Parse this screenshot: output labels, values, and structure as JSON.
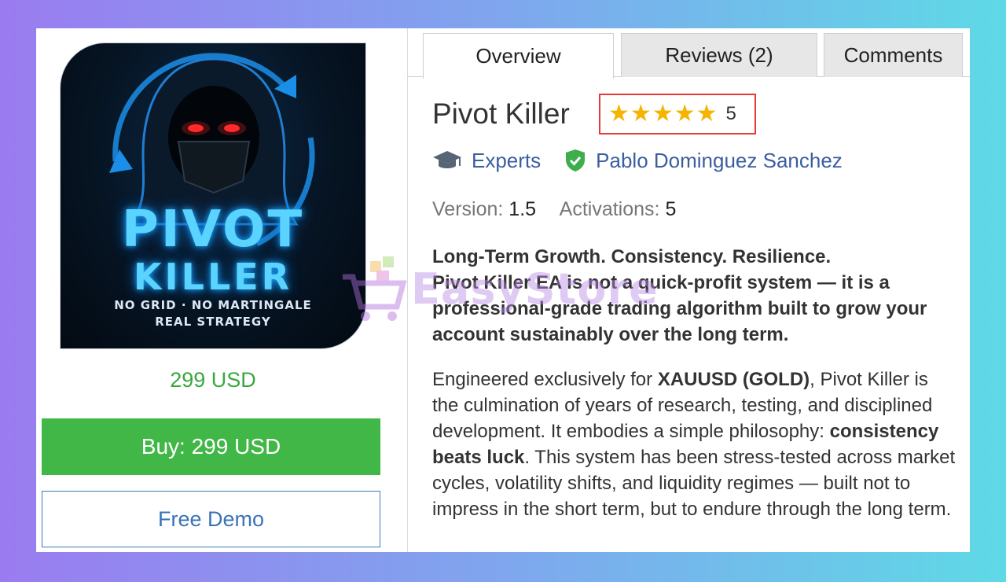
{
  "tabs": [
    {
      "label": "Overview"
    },
    {
      "label": "Reviews (2)"
    },
    {
      "label": "Comments"
    }
  ],
  "product": {
    "title": "Pivot Killer",
    "rating_value": "5",
    "category": "Experts",
    "author": "Pablo Dominguez Sanchez",
    "version_label": "Version:",
    "version_value": "1.5",
    "activations_label": "Activations:",
    "activations_value": "5",
    "price": "299 USD",
    "buy_label": "Buy: 299 USD",
    "demo_label": "Free Demo"
  },
  "image": {
    "title_line1": "PIVOT",
    "title_line2": "KILLER",
    "sub_line1": "NO GRID · NO MARTINGALE",
    "sub_line2": "REAL STRATEGY"
  },
  "description": {
    "p1_line1": "Long-Term Growth. Consistency. Resilience.",
    "p1_line2": "Pivot Killer EA is not a quick-profit system — it is a professional-grade trading algorithm built to grow your account sustainably over the long term.",
    "p2_a": "Engineered exclusively for ",
    "p2_b": "XAUUSD (GOLD)",
    "p2_c": ", Pivot Killer is the culmination of years of research, testing, and disciplined development. It embodies a simple philosophy: ",
    "p2_d": "consistency beats luck",
    "p2_e": ". This system has been stress-tested across market cycles, volatility shifts, and liquidity regimes — built not to impress in the short term, but to endure through the long term."
  },
  "watermark": {
    "text": "EasyStore"
  },
  "icons": {
    "category_icon": "graduation-cap-icon",
    "verified_icon": "shield-check-icon",
    "star_icon": "star-icon"
  },
  "colors": {
    "accent_green": "#41b748",
    "link_blue": "#3a5ea0",
    "star_gold": "#f5b400",
    "highlight_red": "#e53935"
  }
}
